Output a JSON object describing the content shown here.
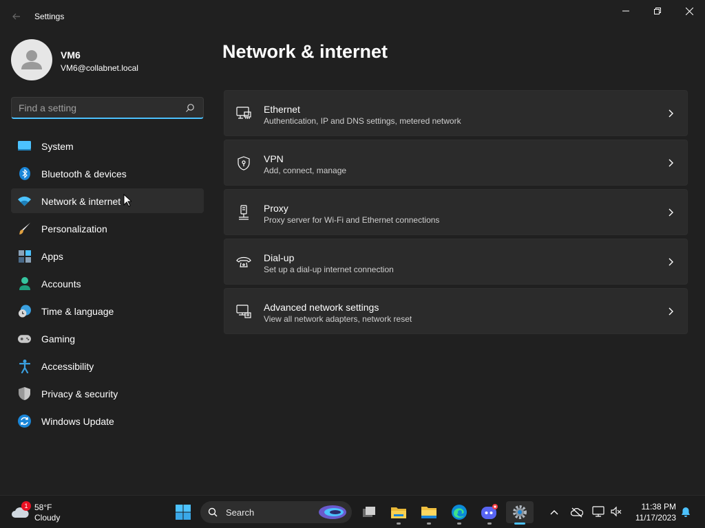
{
  "window": {
    "title": "Settings"
  },
  "profile": {
    "name": "VM6",
    "email": "VM6@collabnet.local"
  },
  "search": {
    "placeholder": "Find a setting"
  },
  "nav": {
    "items": [
      {
        "label": "System",
        "icon": "monitor-icon"
      },
      {
        "label": "Bluetooth & devices",
        "icon": "bluetooth-icon"
      },
      {
        "label": "Network & internet",
        "icon": "wifi-icon",
        "active": true
      },
      {
        "label": "Personalization",
        "icon": "brush-icon"
      },
      {
        "label": "Apps",
        "icon": "apps-icon"
      },
      {
        "label": "Accounts",
        "icon": "person-icon"
      },
      {
        "label": "Time & language",
        "icon": "globe-clock-icon"
      },
      {
        "label": "Gaming",
        "icon": "gamepad-icon"
      },
      {
        "label": "Accessibility",
        "icon": "accessibility-icon"
      },
      {
        "label": "Privacy & security",
        "icon": "shield-icon"
      },
      {
        "label": "Windows Update",
        "icon": "update-icon"
      }
    ]
  },
  "page": {
    "title": "Network & internet"
  },
  "cards": [
    {
      "title": "Ethernet",
      "desc": "Authentication, IP and DNS settings, metered network",
      "icon": "ethernet-icon"
    },
    {
      "title": "VPN",
      "desc": "Add, connect, manage",
      "icon": "vpn-shield-icon"
    },
    {
      "title": "Proxy",
      "desc": "Proxy server for Wi-Fi and Ethernet connections",
      "icon": "proxy-icon"
    },
    {
      "title": "Dial-up",
      "desc": "Set up a dial-up internet connection",
      "icon": "dialup-icon"
    },
    {
      "title": "Advanced network settings",
      "desc": "View all network adapters, network reset",
      "icon": "advanced-network-icon"
    }
  ],
  "taskbar": {
    "weather": {
      "temp": "58°F",
      "condition": "Cloudy",
      "badge": "1"
    },
    "search_label": "Search",
    "clock": {
      "time": "11:38 PM",
      "date": "11/17/2023"
    }
  },
  "colors": {
    "accent": "#4cc2ff",
    "background": "#202020",
    "card": "#2b2b2b"
  }
}
